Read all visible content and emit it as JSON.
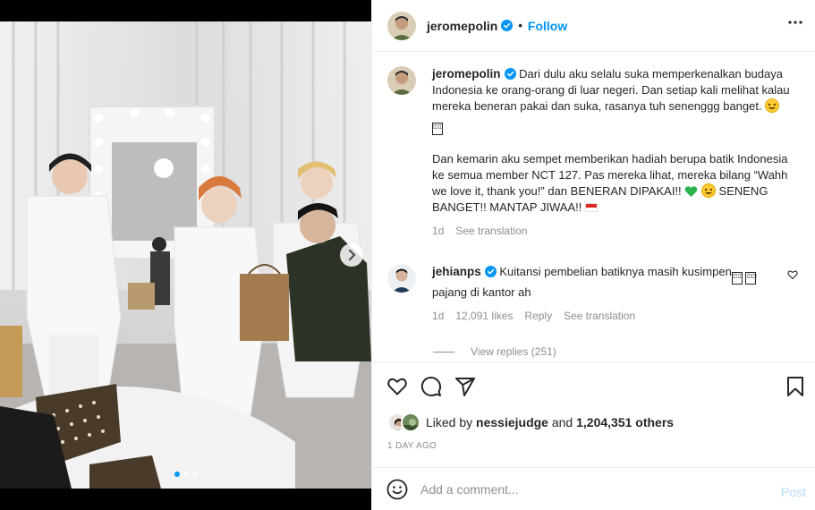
{
  "post_author": {
    "username": "jeromepolin",
    "verified": true,
    "follow_label": "Follow",
    "more_icon": "more-horizontal-icon"
  },
  "media": {
    "carousel_dots": 3,
    "active_dot": 0,
    "next_icon": "chevron-right-icon"
  },
  "caption": {
    "username": "jeromepolin",
    "paragraph1": "Dari dulu aku selalu suka memperkenalkan budaya Indonesia ke orang-orang di luar negeri. Dan setiap kali melihat kalau mereka beneran pakai dan suka, rasanya tuh senenggg banget.",
    "paragraph2_a": "Dan kemarin aku sempet memberikan hadiah berupa batik Indonesia ke semua member NCT 127. Pas mereka lihat, mereka bilang “Wahh we love it, thank you!” dan BENERAN DIPAKAI!!",
    "paragraph2_b": "SENENG BANGET!! MANTAP JIWAA!!",
    "time": "1d",
    "see_translation": "See translation"
  },
  "comment": {
    "username": "jehianps",
    "verified": true,
    "text_a": "Kuitansi pembelian batiknya masih kusimpen",
    "text_b": "pajang di kantor ah",
    "time": "1d",
    "likes": "12,091 likes",
    "reply_label": "Reply",
    "see_translation": "See translation",
    "view_replies": "View replies (251)"
  },
  "actions": {
    "like_icon": "heart-icon",
    "comment_icon": "comment-icon",
    "share_icon": "share-icon",
    "save_icon": "bookmark-icon"
  },
  "likes": {
    "prefix": "Liked by",
    "user": "nessiejudge",
    "and": "and",
    "others": "1,204,351 others"
  },
  "date": "1 DAY AGO",
  "add_comment": {
    "placeholder": "Add a comment...",
    "post_label": "Post",
    "emoji_icon": "smiley-icon"
  },
  "colors": {
    "accent": "#0095f6",
    "muted": "#8e8e8e",
    "post_disabled": "#b3dbff"
  }
}
